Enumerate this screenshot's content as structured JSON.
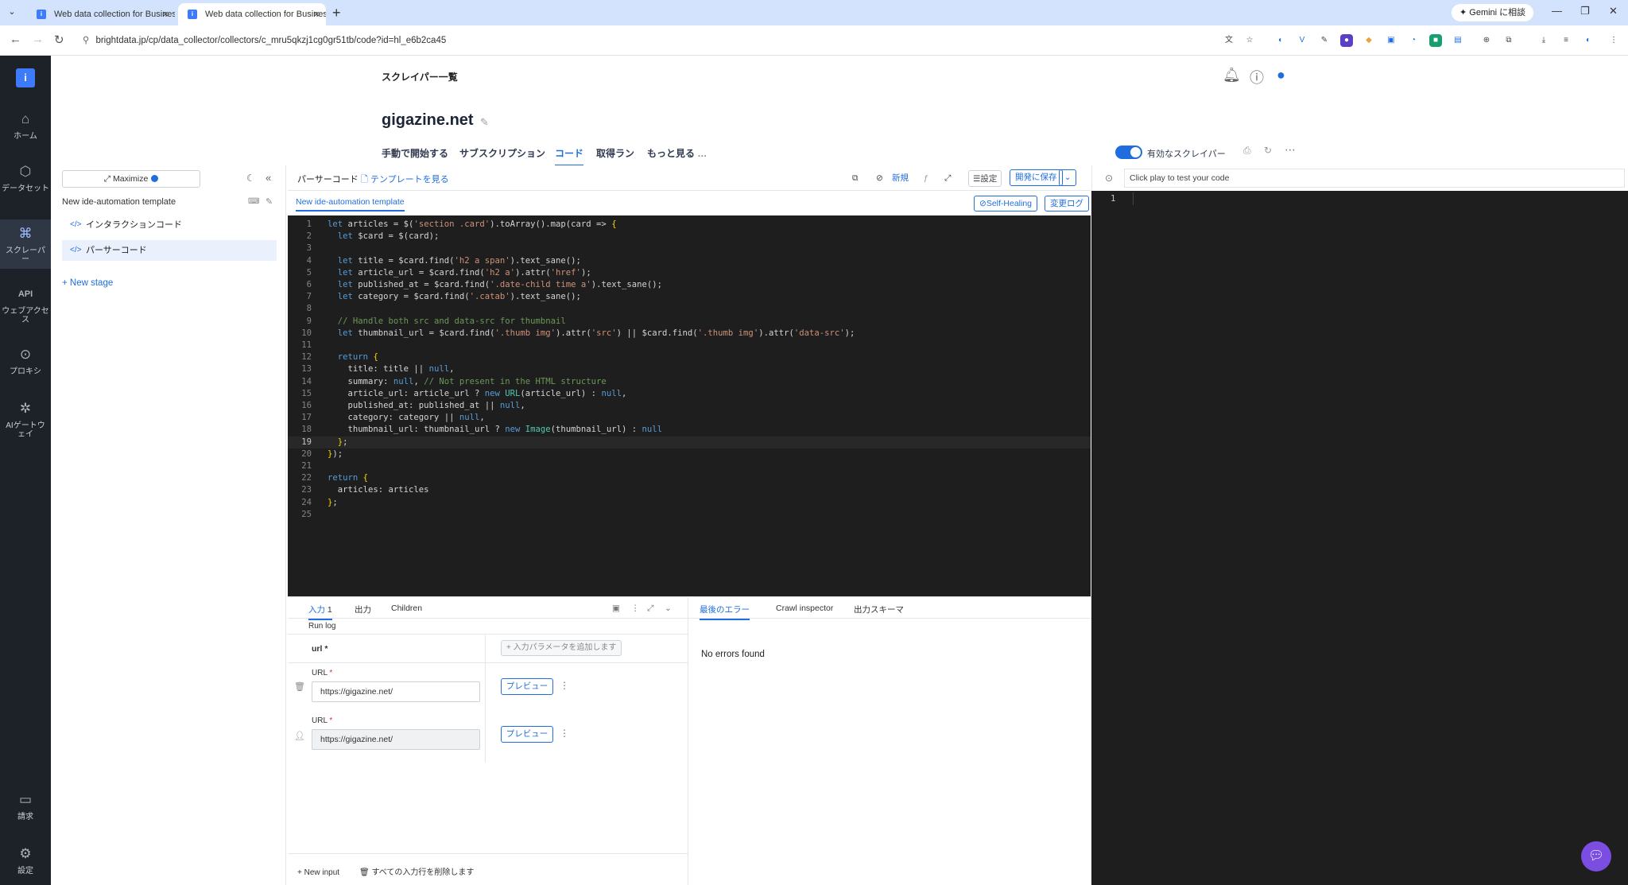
{
  "browser": {
    "tabs": [
      {
        "title": "Web data collection for Business",
        "active": false
      },
      {
        "title": "Web data collection for Business",
        "active": true
      }
    ],
    "url": "brightdata.jp/cp/data_collector/collectors/c_mru5qkzj1cg0gr51tb/code?id=hl_e6b2ca45",
    "gemini_label": "Gemini に相談"
  },
  "rail": {
    "items": [
      {
        "label": "ホーム",
        "icon": "home-icon"
      },
      {
        "label": "データセット",
        "icon": "dataset-icon"
      },
      {
        "label": "スクレーパー",
        "icon": "scraper-icon"
      },
      {
        "label": "ウェブアクセス",
        "icon": "api-icon"
      },
      {
        "label": "プロキシ",
        "icon": "proxy-icon"
      },
      {
        "label": "AIゲートウェイ",
        "icon": "ai-gateway-icon"
      },
      {
        "label": "請求",
        "icon": "billing-icon"
      },
      {
        "label": "設定",
        "icon": "settings-icon"
      }
    ]
  },
  "header": {
    "breadcrumb": "スクレイパー一覧",
    "title": "gigazine.net",
    "tabs": [
      "手動で開始する",
      "サブスクリプション",
      "コード",
      "取得ラン",
      "もっと見る"
    ],
    "active_tab": "コード",
    "toggle_label": "有効なスクレイパー"
  },
  "stages": {
    "maximize_label": "Maximize",
    "template_name": "New ide-automation template",
    "items": [
      "インタラクションコード",
      "パーサーコード"
    ],
    "new_stage": "+ New stage"
  },
  "code_toolbar": {
    "label": "パーサーコード",
    "template_link": "テンプレートを見る",
    "new_label": "新規",
    "settings_label": "設定",
    "save_label": "開発に保存",
    "active_tab": "New ide-automation template",
    "self_healing": "Self-Healing",
    "changelog": "変更ログ"
  },
  "code_lines": [
    "let articles = $('section .card').toArray().map(card => {",
    "  let $card = $(card);",
    "",
    "  let title = $card.find('h2 a span').text_sane();",
    "  let article_url = $card.find('h2 a').attr('href');",
    "  let published_at = $card.find('.date-child time a').text_sane();",
    "  let category = $card.find('.catab').text_sane();",
    "",
    "  // Handle both src and data-src for thumbnail",
    "  let thumbnail_url = $card.find('.thumb img').attr('src') || $card.find('.thumb img').attr('data-src');",
    "",
    "  return {",
    "    title: title || null,",
    "    summary: null, // Not present in the HTML structure",
    "    article_url: article_url ? new URL(article_url) : null,",
    "    published_at: published_at || null,",
    "    category: category || null,",
    "    thumbnail_url: thumbnail_url ? new Image(thumbnail_url) : null",
    "  };",
    "});",
    "",
    "return {",
    "  articles: articles",
    "};",
    ""
  ],
  "current_line": 19,
  "preview": {
    "placeholder": "Click play to test your code",
    "line_number": "1"
  },
  "input_panel": {
    "tabs": [
      "入力",
      "出力",
      "Children"
    ],
    "input_count": "1",
    "run_log": "Run log",
    "url_header": "url *",
    "add_param": "+ 入力パラメータを追加します",
    "rows": [
      {
        "label": "URL",
        "value": "https://gigazine.net/",
        "button": "プレビュー"
      },
      {
        "label": "URL",
        "value": "https://gigazine.net/",
        "button": "プレビュー"
      }
    ],
    "new_input": "+ New input",
    "delete_all": "すべての入力行を削除します"
  },
  "error_panel": {
    "tabs": [
      "最後のエラー",
      "Crawl inspector",
      "出力スキーマ"
    ],
    "message": "No errors found"
  }
}
